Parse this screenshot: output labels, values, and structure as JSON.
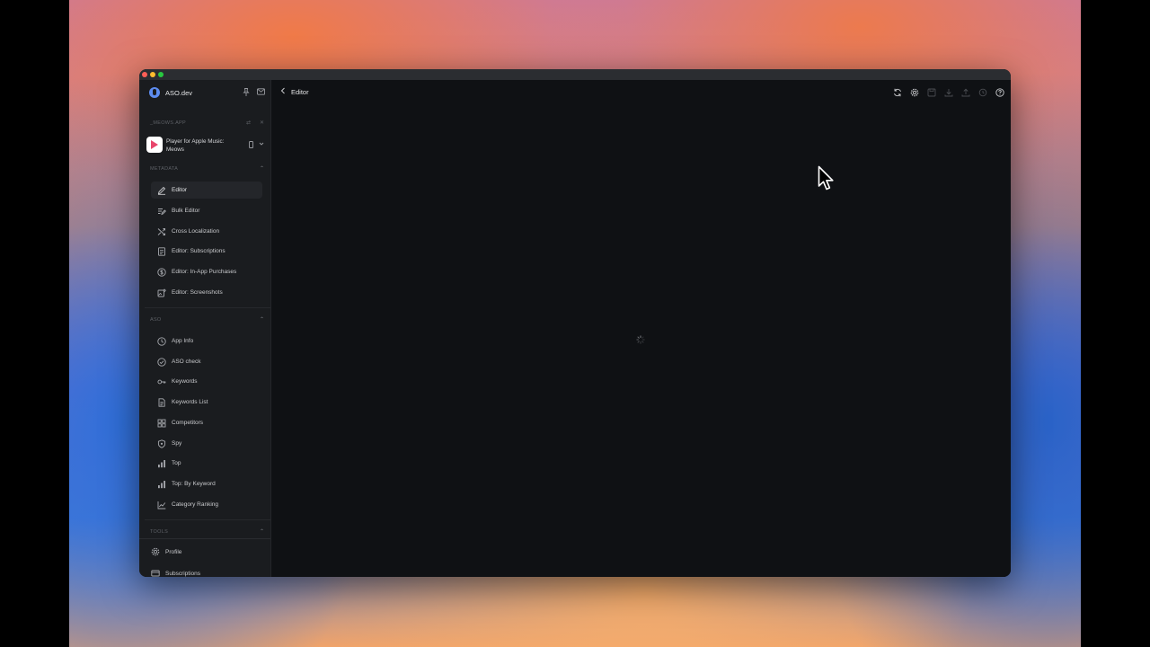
{
  "app": {
    "name": "ASO.dev",
    "project_label": "_MEOWS.APP",
    "app_name": "Player for Apple Music: Meows"
  },
  "sections": {
    "metadata": "METADATA",
    "aso": "ASO",
    "tools": "TOOLS"
  },
  "metadata_items": [
    {
      "label": "Editor",
      "icon": "pencil-icon"
    },
    {
      "label": "Bulk Editor",
      "icon": "bulk-edit-icon"
    },
    {
      "label": "Cross Localization",
      "icon": "shuffle-icon"
    },
    {
      "label": "Editor: Subscriptions",
      "icon": "receipt-icon"
    },
    {
      "label": "Editor: In-App Purchases",
      "icon": "dollar-circle-icon"
    },
    {
      "label": "Editor: Screenshots",
      "icon": "image-edit-icon"
    }
  ],
  "aso_items": [
    {
      "label": "App Info",
      "icon": "clock-icon"
    },
    {
      "label": "ASO check",
      "icon": "check-circle-icon"
    },
    {
      "label": "Keywords",
      "icon": "key-icon"
    },
    {
      "label": "Keywords List",
      "icon": "list-doc-icon"
    },
    {
      "label": "Competitors",
      "icon": "grid-icon"
    },
    {
      "label": "Spy",
      "icon": "shield-icon"
    },
    {
      "label": "Top",
      "icon": "bar-chart-icon"
    },
    {
      "label": "Top: By Keyword",
      "icon": "bar-chart-icon"
    },
    {
      "label": "Category Ranking",
      "icon": "line-chart-icon"
    }
  ],
  "bottom_items": [
    {
      "label": "Profile",
      "icon": "gear-icon"
    },
    {
      "label": "Subscriptions",
      "icon": "card-icon"
    }
  ],
  "main": {
    "title": "Editor"
  },
  "colors": {
    "sidebar_bg": "#1a1c1f",
    "main_bg": "#0f1114",
    "accent": "#5d8cf0",
    "app_icon_accent": "#e8456b"
  }
}
